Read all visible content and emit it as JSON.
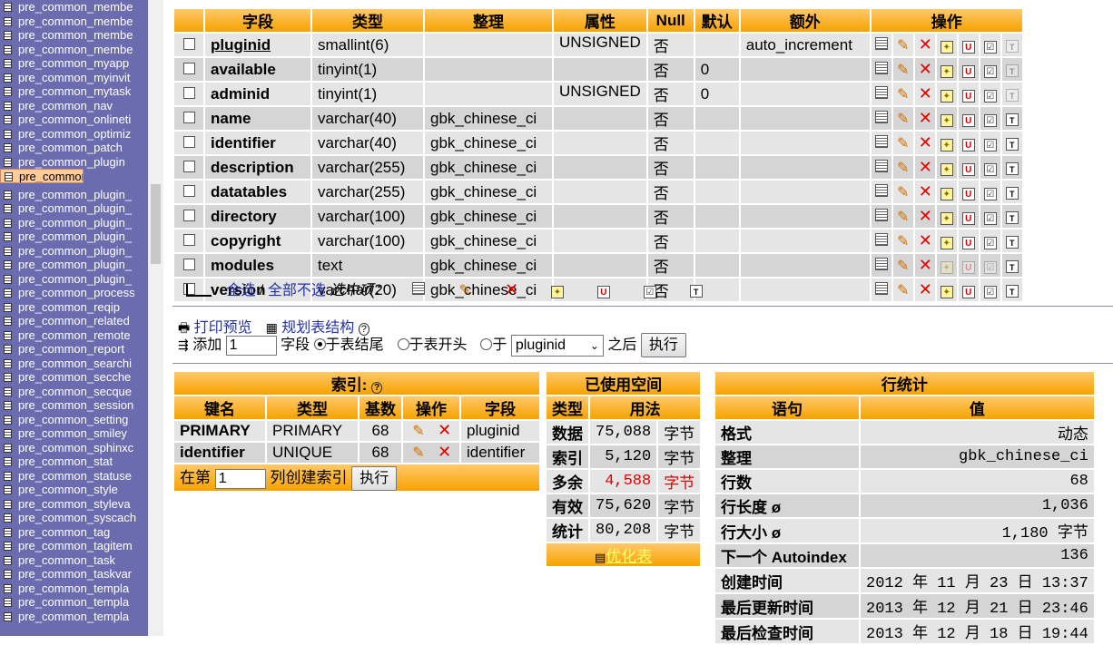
{
  "nav": {
    "items": [
      "pre_common_membe",
      "pre_common_membe",
      "pre_common_membe",
      "pre_common_membe",
      "pre_common_myapp",
      "pre_common_myinvit",
      "pre_common_mytask",
      "pre_common_nav",
      "pre_common_onlineti",
      "pre_common_optimiz",
      "pre_common_patch",
      "pre_common_plugin",
      "pre_common_pluginv",
      "pre_common_plugin_",
      "pre_common_plugin_",
      "pre_common_plugin_",
      "pre_common_plugin_",
      "pre_common_plugin_",
      "pre_common_plugin_",
      "pre_common_plugin_",
      "pre_common_process",
      "pre_common_reqip",
      "pre_common_related",
      "pre_common_remote",
      "pre_common_report",
      "pre_common_searchi",
      "pre_common_secche",
      "pre_common_secque",
      "pre_common_session",
      "pre_common_setting",
      "pre_common_smiley",
      "pre_common_sphinxc",
      "pre_common_stat",
      "pre_common_statuse",
      "pre_common_style",
      "pre_common_styleva",
      "pre_common_syscach",
      "pre_common_tag",
      "pre_common_tagitem",
      "pre_common_task",
      "pre_common_taskvar",
      "pre_common_templa",
      "pre_common_templa",
      "pre_common_templa"
    ],
    "selected_index": 12
  },
  "fields": {
    "headers": [
      "字段",
      "类型",
      "整理",
      "属性",
      "Null",
      "默认",
      "额外",
      "操作"
    ],
    "rows": [
      {
        "name": "pluginid",
        "type": "smallint(6)",
        "collation": "",
        "attr": "UNSIGNED",
        "null": "否",
        "default": "",
        "extra": "auto_increment",
        "primary": true
      },
      {
        "name": "available",
        "type": "tinyint(1)",
        "collation": "",
        "attr": "",
        "null": "否",
        "default": "0",
        "extra": ""
      },
      {
        "name": "adminid",
        "type": "tinyint(1)",
        "collation": "",
        "attr": "UNSIGNED",
        "null": "否",
        "default": "0",
        "extra": ""
      },
      {
        "name": "name",
        "type": "varchar(40)",
        "collation": "gbk_chinese_ci",
        "attr": "",
        "null": "否",
        "default": "",
        "extra": ""
      },
      {
        "name": "identifier",
        "type": "varchar(40)",
        "collation": "gbk_chinese_ci",
        "attr": "",
        "null": "否",
        "default": "",
        "extra": ""
      },
      {
        "name": "description",
        "type": "varchar(255)",
        "collation": "gbk_chinese_ci",
        "attr": "",
        "null": "否",
        "default": "",
        "extra": ""
      },
      {
        "name": "datatables",
        "type": "varchar(255)",
        "collation": "gbk_chinese_ci",
        "attr": "",
        "null": "否",
        "default": "",
        "extra": ""
      },
      {
        "name": "directory",
        "type": "varchar(100)",
        "collation": "gbk_chinese_ci",
        "attr": "",
        "null": "否",
        "default": "",
        "extra": ""
      },
      {
        "name": "copyright",
        "type": "varchar(100)",
        "collation": "gbk_chinese_ci",
        "attr": "",
        "null": "否",
        "default": "",
        "extra": ""
      },
      {
        "name": "modules",
        "type": "text",
        "collation": "gbk_chinese_ci",
        "attr": "",
        "null": "否",
        "default": "",
        "extra": ""
      },
      {
        "name": "version",
        "type": "varchar(20)",
        "collation": "gbk_chinese_ci",
        "attr": "",
        "null": "否",
        "default": "",
        "extra": ""
      }
    ]
  },
  "selection": {
    "select_all": "全选",
    "slash": "/",
    "unselect_all": "全部不选",
    "with_selected": "选中项："
  },
  "tools": {
    "print_preview": "打印预览",
    "propose_structure": "规划表结构"
  },
  "add_field": {
    "add_label": "添加",
    "count_value": "1",
    "field_label": "字段",
    "at_end": "于表结尾",
    "at_begin": "于表开头",
    "after_label": "于",
    "after_column": "pluginid",
    "after_suffix": "之后",
    "execute": "执行"
  },
  "index": {
    "title": "索引:",
    "headers": [
      "键名",
      "类型",
      "基数",
      "操作",
      "字段"
    ],
    "rows": [
      {
        "key": "PRIMARY",
        "type": "PRIMARY",
        "cardinality": "68",
        "field": "pluginid"
      },
      {
        "key": "identifier",
        "type": "UNIQUE",
        "cardinality": "68",
        "field": "identifier"
      }
    ],
    "create_prefix": "在第",
    "create_value": "1",
    "create_suffix": "列创建索引",
    "execute": "执行"
  },
  "space": {
    "title": "已使用空间",
    "headers": [
      "类型",
      "用法"
    ],
    "rows": [
      {
        "type": "数据",
        "value": "75,088",
        "unit": "字节",
        "overhead": false
      },
      {
        "type": "索引",
        "value": "5,120",
        "unit": "字节",
        "overhead": false
      },
      {
        "type": "多余",
        "value": "4,588",
        "unit": "字节",
        "overhead": true
      },
      {
        "type": "有效",
        "value": "75,620",
        "unit": "字节",
        "overhead": false
      },
      {
        "type": "统计",
        "value": "80,208",
        "unit": "字节",
        "overhead": false
      }
    ],
    "optimize": "优化表"
  },
  "stats": {
    "title": "行统计",
    "headers": [
      "语句",
      "值"
    ],
    "rows": [
      {
        "label": "格式",
        "value": "动态",
        "mono": false
      },
      {
        "label": "整理",
        "value": "gbk_chinese_ci",
        "mono": true
      },
      {
        "label": "行数",
        "value": "68",
        "mono": true
      },
      {
        "label": "行长度 ø",
        "value": "1,036",
        "mono": true
      },
      {
        "label": "行大小 ø",
        "value": "1,180 字节",
        "mono": true
      },
      {
        "label": "下一个 Autoindex",
        "value": "136",
        "mono": true
      },
      {
        "label": "创建时间",
        "value": "2012 年 11 月 23 日 13:37",
        "mono": true
      },
      {
        "label": "最后更新时间",
        "value": "2013 年 12 月 21 日 23:46",
        "mono": true
      },
      {
        "label": "最后检查时间",
        "value": "2013 年 12 月 18 日 19:44",
        "mono": true
      }
    ]
  },
  "colors": {
    "nav_bg": "#6b6bb0",
    "header_orange": "#f7a300",
    "overhead_red": "#e00000"
  }
}
